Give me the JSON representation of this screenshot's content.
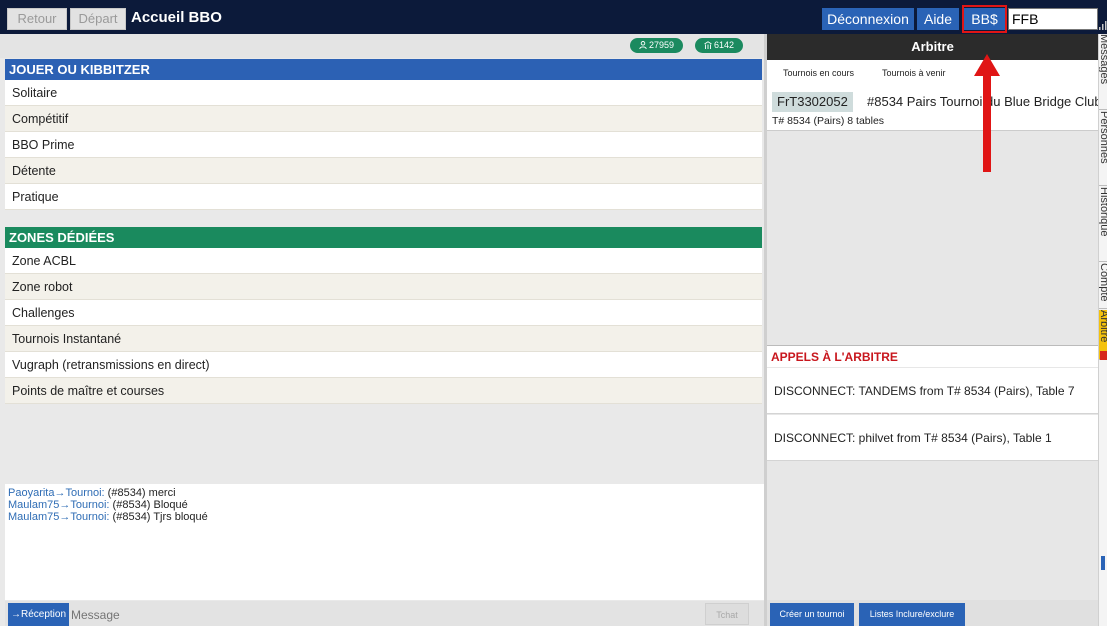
{
  "topbar": {
    "back_label": "Retour",
    "depart_label": "Départ",
    "title": "Accueil BBO",
    "logout_label": "Déconnexion",
    "help_label": "Aide",
    "bb_label": "BB$",
    "field_value": "FFB"
  },
  "counts": {
    "users": "27959",
    "tables": "6142"
  },
  "sections": {
    "play": {
      "title": "JOUER OU KIBBITZER",
      "items": [
        "Solitaire",
        "Compétitif",
        "BBO Prime",
        "Détente",
        "Pratique"
      ]
    },
    "zones": {
      "title": "ZONES DÉDIÉES",
      "items": [
        "Zone ACBL",
        "Zone robot",
        "Challenges",
        "Tournois Instantané",
        "Vugraph (retransmissions en direct)",
        "Points de maître et courses"
      ]
    }
  },
  "chat": {
    "lines": [
      {
        "from": "Paoyarita",
        "to": "Tournoi:",
        "msg": " (#8534) merci"
      },
      {
        "from": "Maulam75",
        "to": "Tournoi:",
        "msg": " (#8534) Bloqué"
      },
      {
        "from": "Maulam75",
        "to": "Tournoi:",
        "msg": " (#8534) Tjrs bloqué"
      }
    ],
    "reception_label": "→Réception",
    "message_placeholder": "Message",
    "send_label": "Tchat"
  },
  "arbitre": {
    "title": "Arbitre",
    "tab_current": "Tournois en cours",
    "tab_upcoming": "Tournois à venir",
    "tournament": {
      "id": "FrT3302052",
      "name": "#8534 Pairs Tournoi du Blue Bridge Club",
      "info": "T# 8534 (Pairs) 8 tables"
    },
    "calls_title": "APPELS À L'ARBITRE",
    "calls": [
      "DISCONNECT: TANDEMS from T# 8534 (Pairs), Table 7",
      "DISCONNECT: philvet from T# 8534 (Pairs), Table 1"
    ],
    "create_label": "Créer un tournoi",
    "lists_label": "Listes Inclure/exclure"
  },
  "side_tabs": [
    "Messages",
    "Personnes",
    "Historique",
    "Compte",
    "Arbitre"
  ],
  "colors": {
    "topbar": "#0c1a3a",
    "accent_blue": "#2a63b6",
    "accent_green": "#1a8a5e",
    "alert_red": "#c8161d",
    "highlight_red": "#e01515"
  },
  "icons": [
    "user-icon",
    "table-icon",
    "signal-icon",
    "arrow-up-annotation"
  ]
}
